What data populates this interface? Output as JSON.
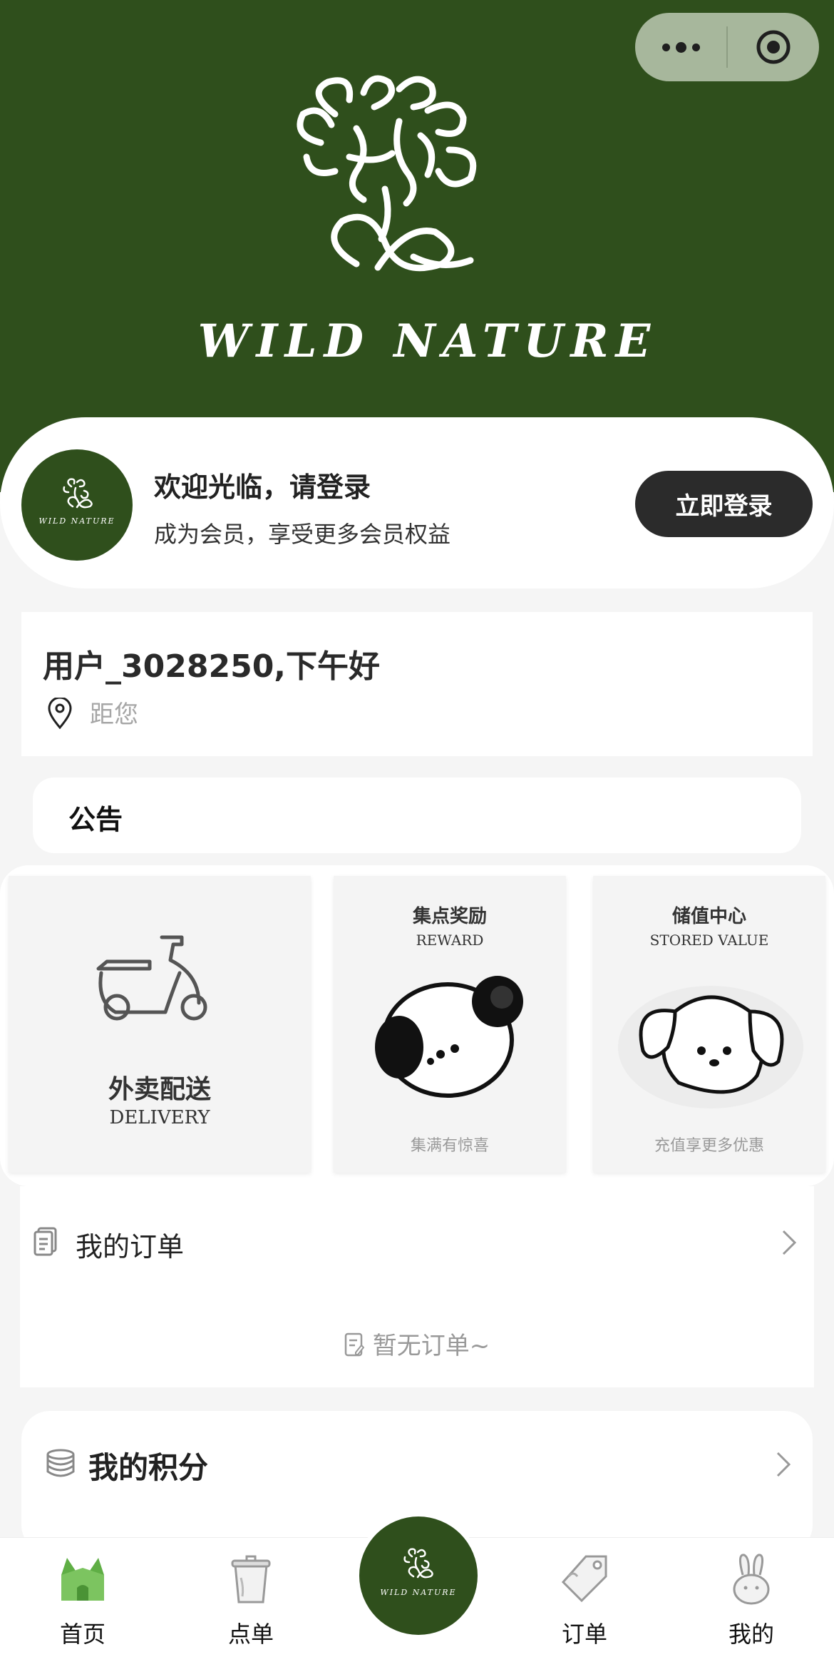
{
  "hero": {
    "brand_name": "WILD NATURE",
    "background_color": "#2f4f1c",
    "capsule": {
      "menu_icon": "more-dots-icon",
      "close_icon": "target-icon"
    }
  },
  "login": {
    "title": "欢迎光临，请登录",
    "subtitle": "成为会员，享受更多会员权益",
    "button": "立即登录",
    "avatar_brand": "WILD NATURE"
  },
  "greeting": {
    "title": "用户_3028250,下午好",
    "location_label": "距您",
    "location_icon": "location-pin-icon"
  },
  "notice": {
    "label": "公告"
  },
  "features": [
    {
      "cn": "外卖配送",
      "en": "DELIVERY",
      "icon": "scooter-icon"
    },
    {
      "cn": "集点奖励",
      "en": "REWARD",
      "footer": "集满有惊喜",
      "icon": "panda-face-icon"
    },
    {
      "cn": "储值中心",
      "en": "STORED VALUE",
      "footer": "充值享更多优惠",
      "icon": "puppy-face-icon"
    }
  ],
  "orders": {
    "title": "我的订单",
    "empty_text": "暂无订单~",
    "icon": "document-icon"
  },
  "points": {
    "title": "我的积分",
    "icon": "coin-stack-icon"
  },
  "tabbar": {
    "items": [
      {
        "label": "首页",
        "icon": "home-house-icon",
        "active": true
      },
      {
        "label": "点单",
        "icon": "cup-icon"
      },
      {
        "label": "订单",
        "icon": "tag-icon"
      },
      {
        "label": "我的",
        "icon": "bunny-icon"
      }
    ],
    "center_brand": "WILD NATURE",
    "active_color": "#5fae45"
  }
}
